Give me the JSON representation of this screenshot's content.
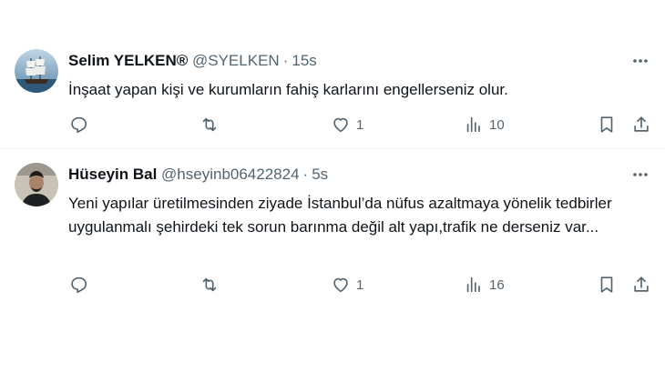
{
  "tweets": [
    {
      "author_name": "Selim YELKEN®",
      "handle": "@SYELKEN",
      "separator": "·",
      "time": "15s",
      "text": "İnşaat yapan kişi ve kurumların fahiş karlarını engellerseniz olur.",
      "reply_count": "",
      "retweet_count": "",
      "like_count": "1",
      "view_count": "10",
      "avatar_icon": "sailing-ship-avatar"
    },
    {
      "author_name": "Hüseyin Bal",
      "handle": "@hseyinb06422824",
      "separator": "·",
      "time": "5s",
      "text": "Yeni yapılar üretilmesinden ziyade İstanbul’da nüfus azaltmaya yönelik tedbirler uygulanmalı şehirdeki tek sorun barınma değil alt yapı,trafik ne derseniz var...",
      "reply_count": "",
      "retweet_count": "",
      "like_count": "1",
      "view_count": "16",
      "avatar_icon": "person-photo-avatar"
    }
  ],
  "colors": {
    "text_primary": "#0f1419",
    "text_secondary": "#536471",
    "divider": "#eff3f4"
  }
}
